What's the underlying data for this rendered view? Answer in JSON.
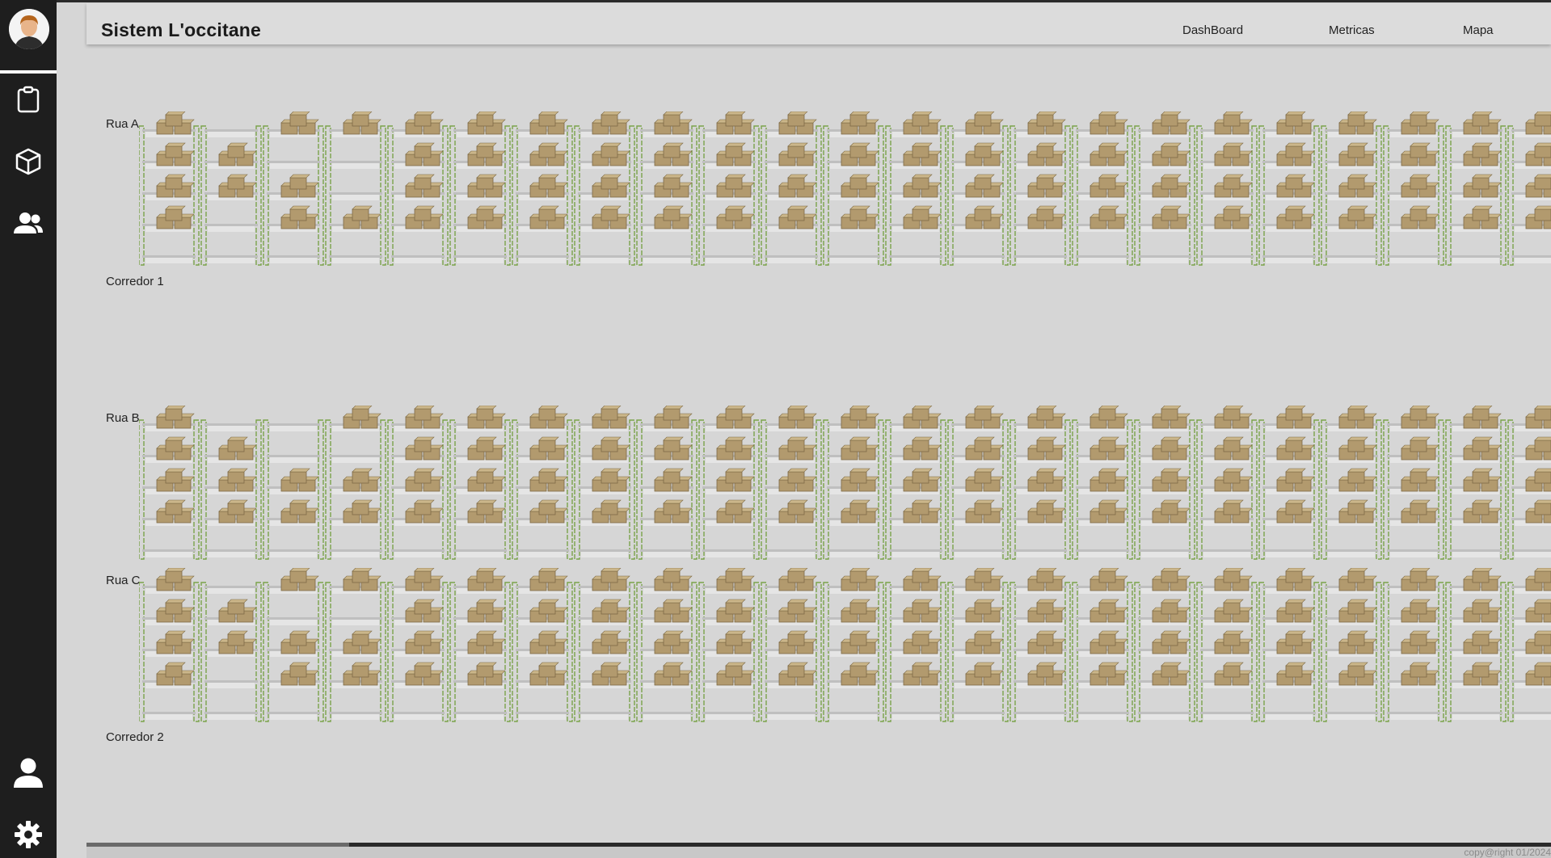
{
  "app": {
    "title": "Sistem L'occitane"
  },
  "nav": {
    "items": [
      "DashBoard",
      "Metricas",
      "Mapa"
    ]
  },
  "sidebar": {
    "top_icons": [
      "clipboard-icon",
      "box-icon",
      "users-icon"
    ],
    "bottom_icons": [
      "user-icon",
      "gear-icon"
    ]
  },
  "map": {
    "rows": [
      {
        "label": "Rua A"
      },
      {
        "label": "Rua B"
      },
      {
        "label": "Rua C"
      }
    ],
    "corridors": [
      {
        "label": "Corredor 1"
      },
      {
        "label": "Corredor 2"
      }
    ]
  },
  "footer": {
    "copyright": "copy@right 01/2024"
  },
  "colors": {
    "sidebar": "#1e1e1e",
    "background": "#d6d6d6",
    "rack": "#7aa34a",
    "box": "#b29a6e"
  }
}
